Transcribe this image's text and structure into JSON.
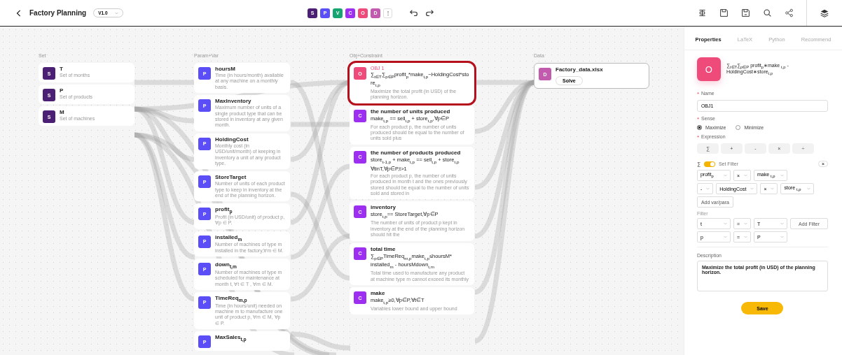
{
  "topbar": {
    "title": "Factory Planning",
    "version": "V1.0",
    "chips": [
      {
        "label": "S",
        "color": "#4b1f74"
      },
      {
        "label": "P",
        "color": "#5b4ef6"
      },
      {
        "label": "V",
        "color": "#16a571"
      },
      {
        "label": "C",
        "color": "#9d2ff1"
      },
      {
        "label": "O",
        "color": "#ee4b7b"
      },
      {
        "label": "D",
        "color": "#c25aae"
      }
    ],
    "more": "⋮"
  },
  "columns": [
    {
      "heading": "Set",
      "nodes": [
        {
          "kind": "set",
          "badge": "S",
          "title": "T",
          "description": "Set of months",
          "selected": false
        },
        {
          "kind": "set",
          "badge": "S",
          "title": "P",
          "description": "Set of products",
          "selected": false
        },
        {
          "kind": "set",
          "badge": "S",
          "title": "M",
          "description": "Set of machines",
          "selected": false
        }
      ]
    },
    {
      "heading": "Param+Var",
      "nodes": [
        {
          "kind": "param",
          "badge": "P",
          "title": "hoursM",
          "description": "Time (in hours/month) available at any machine on a monthly basis.",
          "selected": false
        },
        {
          "kind": "param",
          "badge": "P",
          "title": "MaxInventory",
          "description": "Maximum number of units of a single product type that can be stored in inventory at any given month.",
          "selected": false
        },
        {
          "kind": "param",
          "badge": "P",
          "title": "HoldingCost",
          "description": "Monthly cost (in USD/unit/month) of keeping in inventory a unit of any product type.",
          "selected": false
        },
        {
          "kind": "param",
          "badge": "P",
          "title": "StoreTarget",
          "description": "Number of units of each product type to keep in inventory at the end of the planning horizon.",
          "selected": false
        },
        {
          "kind": "param",
          "badge": "P",
          "title": "profit$_{p}$",
          "description": "Profit (in USD/unit) of product p, ∀p ∈ P.",
          "selected": false
        },
        {
          "kind": "param",
          "badge": "P",
          "title": "installed$_{m}$",
          "description": "Number of machines of type m installed in the factory,∀m ∈ M.",
          "selected": false
        },
        {
          "kind": "param",
          "badge": "P",
          "title": "down$_{t,m}$",
          "description": "Number of machines of type m scheduled for maintenance at month t, ∀t ∈ T , ∀m ∈ M.",
          "selected": false
        },
        {
          "kind": "param",
          "badge": "P",
          "title": "TimeReq$_{m,p}$",
          "description": "Time (in hours/unit) needed on machine m to manufacture one unit of product p, ∀m ∈ M, ∀p ∈ P.",
          "selected": false
        },
        {
          "kind": "param",
          "badge": "P",
          "title": "MaxSales$_{t,p}$",
          "selected": false
        }
      ]
    },
    {
      "heading": "Obj+Constraint",
      "nodes": [
        {
          "kind": "objective",
          "badge": "O",
          "label": "OBJ 1",
          "formula": [
            "∑$_{t∈T}$∑$_{p∈P}$profit$_{p}$*make$_{t,p}$−HoldingCost*store$_{t,p}$"
          ],
          "description": "Maximize the total profit (in USD) of the planning horizon.",
          "selected": true
        },
        {
          "kind": "constraint",
          "badge": "C",
          "title": "the number of units produced",
          "formula": [
            "make$_{t,p}$ == sell$_{t,p}$ + store$_{t,p}$,∀p∈P"
          ],
          "description": "For each product p, the number of units produced should be equal to the number of units sold plus",
          "selected": false
        },
        {
          "kind": "constraint",
          "badge": "C",
          "title": "the number of products produced",
          "formula": [
            "store$_{t-1,p}$ + make$_{t,p}$ == sell$_{t,p}$ + store$_{t,p}$",
            "∀tinT,∀p∈P,t>1"
          ],
          "description": "For each product p, the number of units produced in month t and the ones previously stored should be equal to the number of units sold and stored in",
          "selected": false
        },
        {
          "kind": "constraint",
          "badge": "C",
          "title": "inventory",
          "formula": [
            "store$_{t,p}$== StoreTarget,∀p∈P"
          ],
          "description": "The number of units of product p kept in inventory at the end of the planning horizon should hit the",
          "selected": false
        },
        {
          "kind": "constraint",
          "badge": "C",
          "title": "total time",
          "formula": [
            "∑$_{p∈P}$TimeReq$_{m,p}$make$_{t,p}$≤hoursM*",
            "installed$_{m}$ - hoursMdown$_{t,m}$"
          ],
          "description": "Total time used to manufacture any product at machine type m cannot exceed its monthly",
          "selected": false
        },
        {
          "kind": "constraint",
          "badge": "C",
          "title": "make",
          "formula": [
            "make$_{t,p}$≥0,∀p∈P,∀t∈T"
          ],
          "description": "Variables lower bound and upper bound",
          "selected": false
        }
      ]
    },
    {
      "heading": "Data",
      "nodes": [
        {
          "kind": "data",
          "badge": "D",
          "title": "Factory_data.xlsx",
          "button": "Solve",
          "selected": false
        }
      ]
    }
  ],
  "panel": {
    "tabs": [
      {
        "label": "Properties",
        "selected": true
      },
      {
        "label": "LaTeX",
        "selected": false
      },
      {
        "label": "Python",
        "selected": false
      },
      {
        "label": "Recommend",
        "selected": false
      }
    ],
    "badge": "O",
    "formula": "∑$_{t∈T}$∑$_{p∈P}$ profit$_{p}$∗make $_{t,p}$ - HoldingCost∗store$_{t,p}$",
    "name_label": {
      "mark": "*",
      "text": "Name"
    },
    "name_value": "OBJ1",
    "sense_label": {
      "mark": "*",
      "text": "Sense"
    },
    "sense_options": [
      {
        "label": "Maximize",
        "selected": true
      },
      {
        "label": "Minimize",
        "selected": false
      }
    ],
    "expression_label": {
      "mark": "*",
      "text": "Expression"
    },
    "operators": [
      "∑",
      "+",
      "-",
      "×",
      "÷"
    ],
    "filter_toggle": {
      "symbol": "∑",
      "on": true,
      "label": "Set Filter",
      "close": "×"
    },
    "expression_rows": [
      [
        {
          "kind": "select",
          "value": "profit$_{p}$"
        },
        {
          "kind": "select",
          "value": "×"
        },
        {
          "kind": "select",
          "value": "make $_{t,p}$"
        }
      ],
      [
        {
          "kind": "select",
          "value": "-"
        },
        {
          "kind": "select",
          "value": "HoldingCost"
        },
        {
          "kind": "select",
          "value": "×"
        },
        {
          "kind": "select",
          "value": "store $_{t,p}$"
        }
      ],
      [
        {
          "kind": "button",
          "value": "Add var/para"
        }
      ]
    ],
    "filter_label": "Filter",
    "filter_rows": [
      [
        {
          "kind": "select",
          "value": "t"
        },
        {
          "kind": "select",
          "value": "="
        },
        {
          "kind": "select",
          "value": "T"
        },
        {
          "kind": "button",
          "value": "Add Filter"
        }
      ],
      [
        {
          "kind": "select",
          "value": "p"
        },
        {
          "kind": "select",
          "value": "="
        },
        {
          "kind": "select",
          "value": "P"
        }
      ]
    ],
    "description_label": "Description",
    "description": "Maximize the total profit (in USD) of the planning horizon.",
    "save": "Save"
  }
}
